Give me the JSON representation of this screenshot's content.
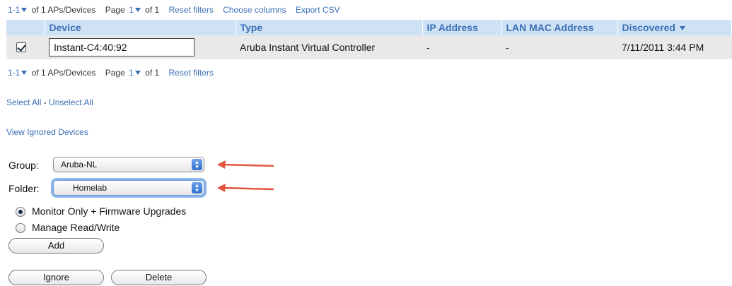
{
  "pager_top": {
    "range": "1-1",
    "of_text": "of 1 APs/Devices",
    "page_label": "Page",
    "page": "1",
    "page_of": "of 1",
    "reset": "Reset filters",
    "choose_columns": "Choose columns",
    "export": "Export CSV"
  },
  "table": {
    "columns": [
      "Device",
      "Type",
      "IP Address",
      "LAN MAC Address",
      "Discovered"
    ],
    "row": {
      "checked": true,
      "device": "Instant-C4:40:92",
      "type": "Aruba Instant Virtual Controller",
      "ip": "-",
      "mac": "-",
      "discovered": "7/11/2011 3:44 PM"
    }
  },
  "pager_bottom": {
    "range": "1-1",
    "of_text": "of 1 APs/Devices",
    "page_label": "Page",
    "page": "1",
    "page_of": "of 1",
    "reset": "Reset filters"
  },
  "links": {
    "select_all": "Select All",
    "separator": "-",
    "unselect_all": "Unselect All",
    "view_ignored": "View Ignored Devices"
  },
  "form": {
    "group_label": "Group:",
    "group_value": "Aruba-NL",
    "folder_label": "Folder:",
    "folder_value": "Homelab",
    "mode_options": [
      {
        "label": "Monitor Only + Firmware Upgrades",
        "selected": true
      },
      {
        "label": "Manage Read/Write",
        "selected": false
      }
    ],
    "add": "Add",
    "ignore": "Ignore",
    "delete": "Delete"
  },
  "colors": {
    "link": "#3b6fb6",
    "header_bg": "#cfe2f5",
    "row_bg": "#e9e9e9",
    "arrow": "#e2553f"
  }
}
